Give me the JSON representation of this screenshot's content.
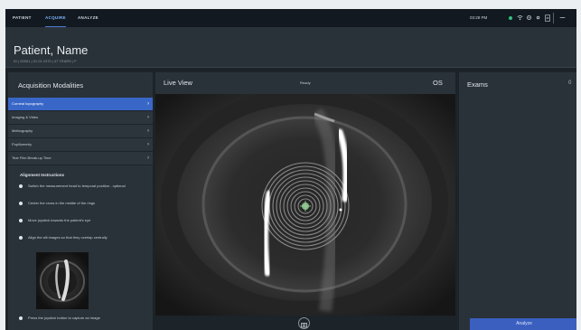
{
  "topbar": {
    "tabs": [
      {
        "label": "PATIENT",
        "active": false
      },
      {
        "label": "ACQUIRE",
        "active": true
      },
      {
        "label": "ANALYZE",
        "active": false
      }
    ],
    "time": "03:28 PM",
    "status_color": "#2ec27e",
    "icons": [
      "wifi-icon",
      "settings-icon",
      "gear-icon",
      "document-icon",
      "minimize-icon"
    ]
  },
  "header": {
    "patient_name": "Patient, Name",
    "patient_sub": "ID | 00001 | 01.01.1970 | 47 YEARS | F"
  },
  "left_panel": {
    "title": "Acquisition Modalities",
    "modalities": [
      {
        "label": "Corneal topography",
        "active": true
      },
      {
        "label": "Imaging & Video",
        "active": false
      },
      {
        "label": "Meibography",
        "active": false
      },
      {
        "label": "Pupillometry",
        "active": false
      },
      {
        "label": "Tear Film Break-up Time",
        "active": false
      }
    ],
    "instructions_title": "Alignment Instructions",
    "steps": [
      "Switch the measurement head to temporal position - optional",
      "Center the cross in the middle of the rings",
      "Move joystick towards the patient's eye",
      "Align the slit images so that they overlap centrally",
      "Press the joystick button to capture an image"
    ]
  },
  "center_panel": {
    "title": "Live View",
    "status": "Ready",
    "eye": "OS"
  },
  "right_panel": {
    "title": "Exams",
    "count": "0",
    "analyze_label": "Analyze"
  }
}
